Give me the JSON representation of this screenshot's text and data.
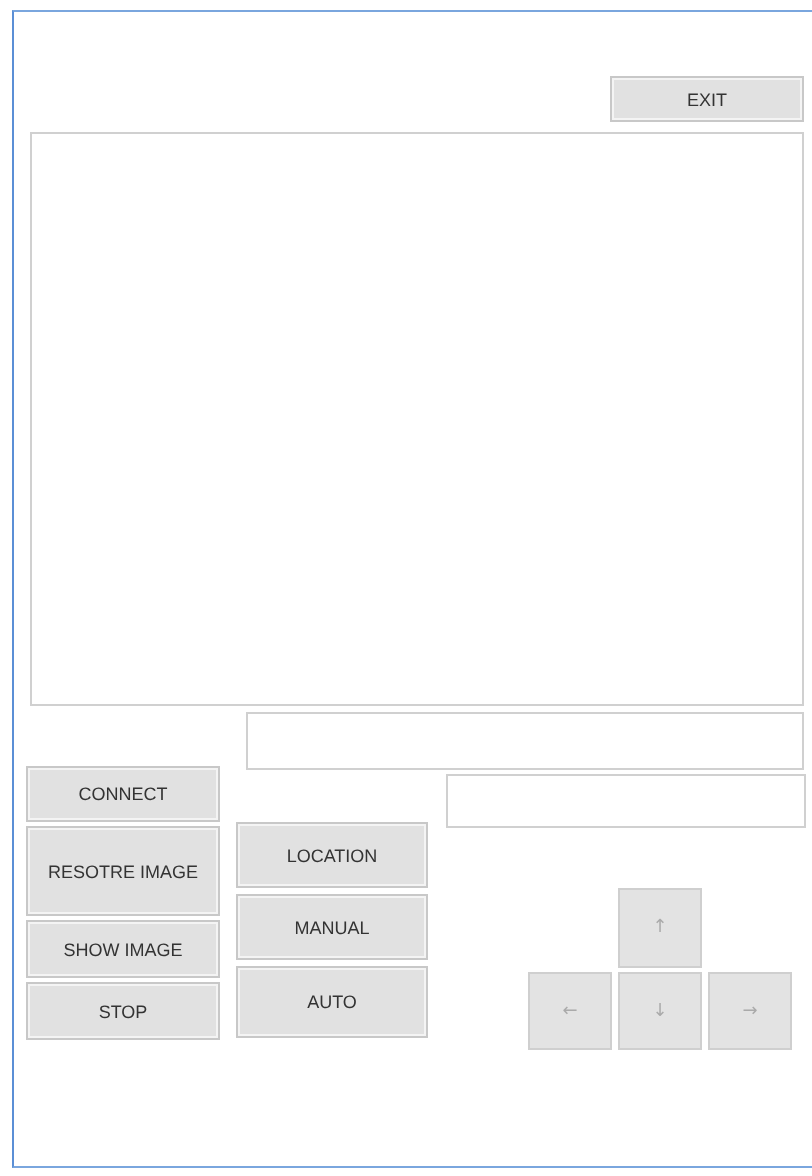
{
  "exit_button": "EXIT",
  "left_buttons": [
    "CONNECT",
    "RESOTRE IMAGE",
    "SHOW IMAGE",
    "STOP"
  ],
  "mode_buttons": [
    "LOCATION",
    "MANUAL",
    "AUTO"
  ],
  "arrow_pad": {
    "up": "↑",
    "left": "←",
    "down": "↓",
    "right": "→"
  }
}
